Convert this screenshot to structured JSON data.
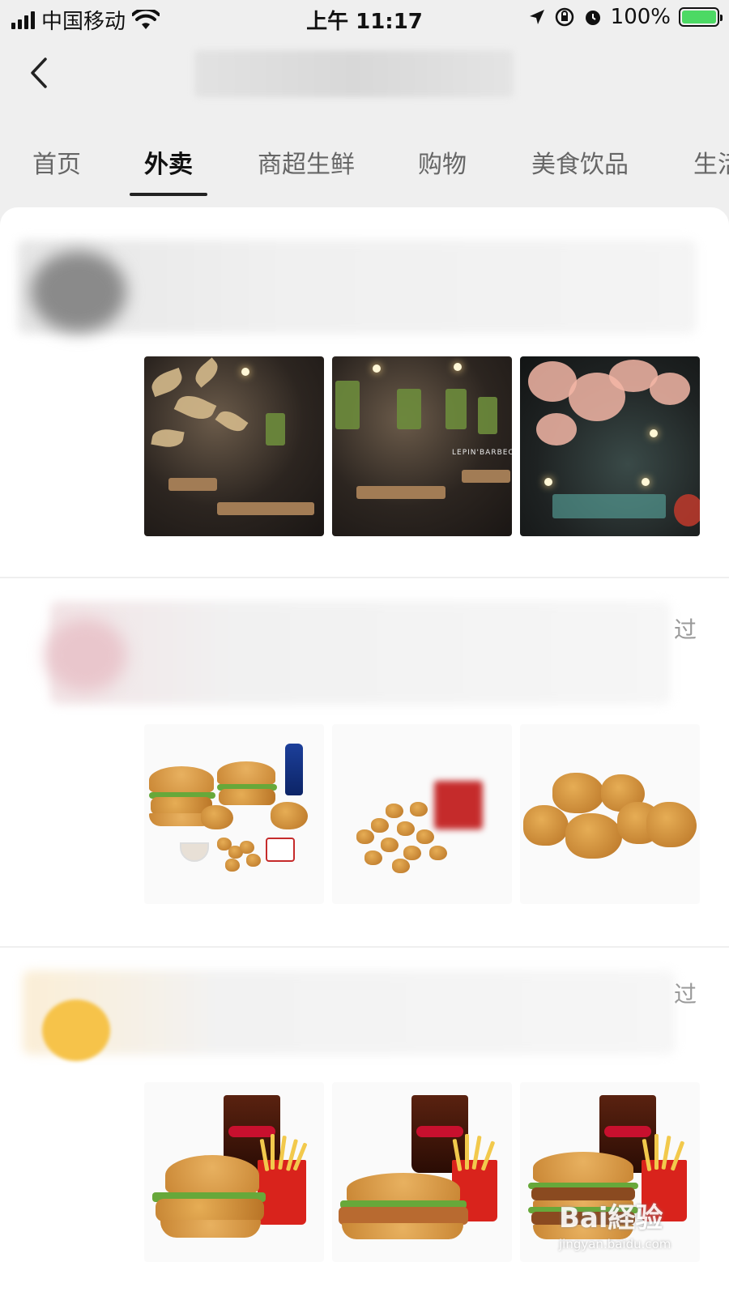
{
  "status_bar": {
    "carrier": "中国移动",
    "time": "上午 11:17",
    "battery_percent": "100%",
    "battery_level": 1.0
  },
  "tabs": [
    {
      "label": "首页",
      "active": false
    },
    {
      "label": "外卖",
      "active": true
    },
    {
      "label": "商超生鲜",
      "active": false
    },
    {
      "label": "购物",
      "active": false
    },
    {
      "label": "美食饮品",
      "active": false
    },
    {
      "label": "生活",
      "active": false
    }
  ],
  "posts": [
    {
      "extra": "",
      "images": [
        "restaurant-interior-1",
        "restaurant-interior-2",
        "restaurant-interior-3"
      ],
      "sign_text": "LEPIN'BARBECU"
    },
    {
      "extra": "过",
      "images": [
        "fried-chicken-burger-combo",
        "popcorn-chicken",
        "chicken-nuggets"
      ]
    },
    {
      "extra": "过",
      "images": [
        "chicken-burger-meal",
        "grilled-chicken-burger-meal",
        "big-mac-meal"
      ]
    }
  ],
  "watermark": {
    "brand": "Bai経验",
    "url": "jingyan.baidu.com"
  },
  "colors": {
    "accent_battery": "#4cd964",
    "background": "#efefef",
    "card": "#ffffff"
  }
}
